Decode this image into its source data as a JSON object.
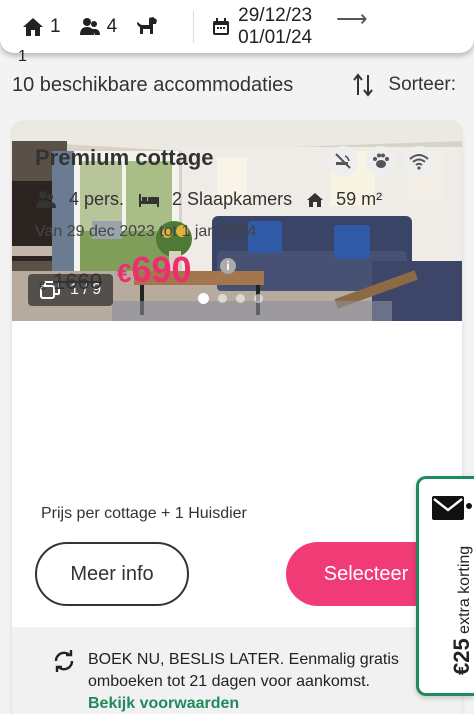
{
  "search": {
    "homes": "1",
    "guests": "4",
    "date_from": "29/12/23",
    "date_to": "01/01/24",
    "date_arrow": "⟶"
  },
  "stray_char": "1",
  "results": {
    "count_label": "10 beschikbare accommodaties",
    "sort_label": "Sorteer:"
  },
  "card": {
    "photo_counter": "1 / 9",
    "carousel_active_index": 0,
    "carousel_dot_count": 4,
    "title": "Premium cottage",
    "features": [
      "no-smoking-icon",
      "paw-icon",
      "wifi-icon"
    ],
    "persons": "4 pers.",
    "bedrooms": "2 Slaapkamers",
    "area": "59 m²",
    "period": "Van 29 dec 2023 tot 1 jan 2024",
    "old_currency": "€",
    "old_price": "1660",
    "new_currency": "€",
    "new_price": "690",
    "info_icon": "i",
    "price_note": "Prijs per cottage + 1 Huisdier",
    "btn_info": "Meer info",
    "btn_select": "Selecteer",
    "promo_text": "BOEK NU, BESLIS LATER. Eenmalig gratis omboeken tot 21 dagen voor aankomst.",
    "promo_link": "Bekijk voorwaarden"
  },
  "side_tab": {
    "amount": "€25",
    "label": "extra korting"
  },
  "colors": {
    "accent_pink": "#f03b76",
    "price_pink": "#ee2d6e",
    "green": "#1f8a5b"
  }
}
